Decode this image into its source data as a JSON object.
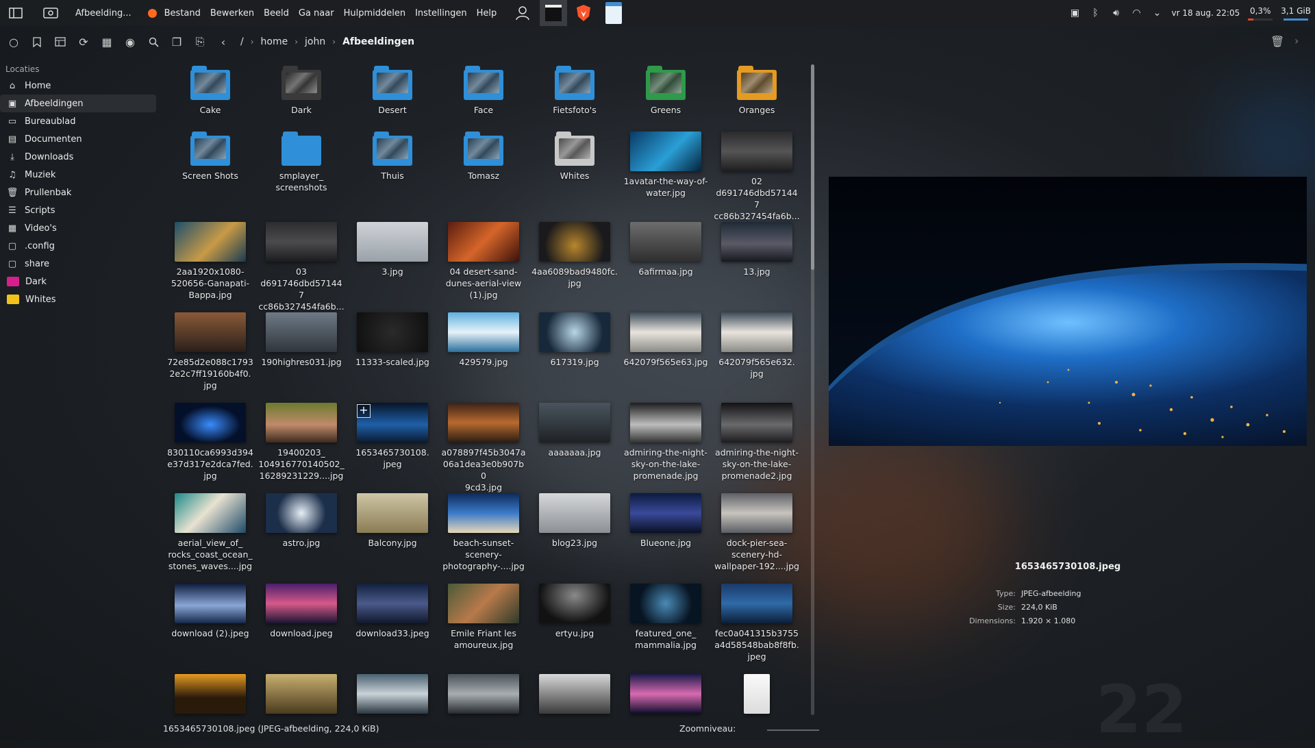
{
  "panel": {
    "app_title": "Afbeelding...",
    "menus": [
      "Bestand",
      "Bewerken",
      "Beeld",
      "Ga naar",
      "Hulpmiddelen",
      "Instellingen",
      "Help"
    ],
    "clock": "vr 18 aug. 22:05",
    "cpu": "0,3%",
    "mem": "3,1 GiB",
    "cpu_level": 0.3,
    "mem_level": 100
  },
  "breadcrumb": {
    "root": "/",
    "parts": [
      "home",
      "john"
    ],
    "current": "Afbeeldingen"
  },
  "sidebar": {
    "heading": "Locaties",
    "items": [
      {
        "label": "Home",
        "icon": "home-icon"
      },
      {
        "label": "Afbeeldingen",
        "icon": "image-icon"
      },
      {
        "label": "Bureaublad",
        "icon": "desktop-icon"
      },
      {
        "label": "Documenten",
        "icon": "document-icon"
      },
      {
        "label": "Downloads",
        "icon": "download-icon"
      },
      {
        "label": "Muziek",
        "icon": "music-icon"
      },
      {
        "label": "Prullenbak",
        "icon": "trash-icon"
      },
      {
        "label": "Scripts",
        "icon": "script-icon"
      },
      {
        "label": "Video's",
        "icon": "video-icon"
      },
      {
        "label": ".config",
        "icon": "folder-icon"
      },
      {
        "label": "share",
        "icon": "folder-icon"
      },
      {
        "label": "Dark",
        "icon": "folder-magenta-icon"
      },
      {
        "label": "Whites",
        "icon": "folder-yellow-icon"
      }
    ]
  },
  "folders": [
    {
      "label": "Cake",
      "color": "#2f8fd8"
    },
    {
      "label": "Dark",
      "color": "#3a3a3a"
    },
    {
      "label": "Desert",
      "color": "#2f8fd8"
    },
    {
      "label": "Face",
      "color": "#2f8fd8"
    },
    {
      "label": "Fietsfoto's",
      "color": "#2f8fd8"
    },
    {
      "label": "Greens",
      "color": "#2e9a4a"
    },
    {
      "label": "Oranges",
      "color": "#e59a22"
    },
    {
      "label": "Screen Shots",
      "color": "#2f8fd8"
    },
    {
      "label": "smplayer_\nscreenshots",
      "color": "#2f8fd8"
    },
    {
      "label": "Thuis",
      "color": "#2f8fd8"
    },
    {
      "label": "Tomasz",
      "color": "#2f8fd8"
    },
    {
      "label": "Whites",
      "color": "#c8c8c8"
    }
  ],
  "files": [
    {
      "label": "1avatar-the-way-of-\nwater.jpg",
      "bg": "linear-gradient(135deg,#0a3a66,#2a9fd6 55%,#05223a)"
    },
    {
      "label": "02\nd691746dbd571447\ncc86b327454fa6b...",
      "bg": "linear-gradient(180deg,#2a2a2c,#555 50%,#1d1d1f)"
    },
    {
      "label": "2aa1920x1080-\n520656-Ganapati-\nBappa.jpg",
      "bg": "linear-gradient(135deg,#1d4f6c,#c89a46 55%,#193a52)"
    },
    {
      "label": "03\nd691746dbd571447\ncc86b327454fa6b...",
      "bg": "linear-gradient(180deg,#2c2c2e,#4b4b4d 50%,#1c1c1e)"
    },
    {
      "label": "3.jpg",
      "bg": "linear-gradient(180deg,#cfd3d8,#9aa1a8)"
    },
    {
      "label": "04 desert-sand-\ndunes-aerial-view\n(1).jpg",
      "bg": "linear-gradient(135deg,#5a1e10,#d6652a 50%,#3a120a)"
    },
    {
      "label": "4aa6089bad9480fc.\njpg",
      "bg": "radial-gradient(circle at 50% 60%,#b8862d,#1a1a1c 70%)"
    },
    {
      "label": "6afirmaa.jpg",
      "bg": "linear-gradient(180deg,#6d6d6d,#2e2e2e)"
    },
    {
      "label": "13.jpg",
      "bg": "linear-gradient(180deg,#1e2a36,#5a5a66 55%,#16191f)"
    },
    {
      "label": "72e85d2e088c1793\n2e2c7ff19160b4f0.\njpg",
      "bg": "linear-gradient(180deg,#8a5a38,#2a1f1a)"
    },
    {
      "label": "190highres031.jpg",
      "bg": "linear-gradient(180deg,#6f7a86,#2f353c)"
    },
    {
      "label": "11333-scaled.jpg",
      "bg": "radial-gradient(circle at 50% 50%,#2a2a2a,#0e0e0e)"
    },
    {
      "label": "429579.jpg",
      "bg": "linear-gradient(180deg,#5fb0e0,#e6f2f8 50%,#2b6f9c)"
    },
    {
      "label": "617319.jpg",
      "bg": "radial-gradient(circle at 50% 50%,#b8d6e6,#16283a 70%)"
    },
    {
      "label": "642079f565e63.jpg",
      "bg": "linear-gradient(180deg,#3c4a58,#e8e4dc 50%,#8a8a86)"
    },
    {
      "label": "642079f565e632.\njpg",
      "bg": "linear-gradient(180deg,#3c4a58,#e8e4dc 50%,#8a8a86)"
    },
    {
      "label": "830110ca6993d394\ne37d317e2dca7fed.\njpg",
      "bg": "radial-gradient(ellipse at 50% 55%,#3a8cff,#04102a 60%)"
    },
    {
      "label": "19400203_\n104916770140502_\n16289231229....jpg",
      "bg": "linear-gradient(180deg,#6c7a2e,#c08a6a 55%,#3d2a1e)"
    },
    {
      "label": "1653465730108.\njpeg",
      "bg": "linear-gradient(180deg,#071428,#1f5fa8 55%,#0a1a30)"
    },
    {
      "label": "a078897f45b3047a\n06a1dea3e0b907b0\n9cd3.jpg",
      "bg": "linear-gradient(180deg,#3a2218,#b86a2e 50%,#2a1c14)"
    },
    {
      "label": "aaaaaaa.jpg",
      "bg": "linear-gradient(180deg,#4a545e,#1e2226)"
    },
    {
      "label": "admiring-the-night-\nsky-on-the-lake-\npromenade.jpg",
      "bg": "linear-gradient(180deg,#1c1c1e,#bdbdbd 55%,#333)"
    },
    {
      "label": "admiring-the-night-\nsky-on-the-lake-\npromenade2.jpg",
      "bg": "linear-gradient(180deg,#121214,#6a6a6c 55%,#1c1c1e)"
    },
    {
      "label": "aerial_view_of_\nrocks_coast_ocean_\nstones_waves....jpg",
      "bg": "linear-gradient(135deg,#1b8a8a,#e8e2d0 45%,#1f4a6a)"
    },
    {
      "label": "astro.jpg",
      "bg": "radial-gradient(circle at 50% 50%,#e6eef6,#1b2e4a 60%)"
    },
    {
      "label": "Balcony.jpg",
      "bg": "linear-gradient(180deg,#cfc6a6,#8a7c54)"
    },
    {
      "label": "beach-sunset-\nscenery-\nphotography-....jpg",
      "bg": "linear-gradient(180deg,#0d2a5a,#3b7ac8 50%,#e6d8b8)"
    },
    {
      "label": "blog23.jpg",
      "bg": "linear-gradient(180deg,#d6d8da,#8c9094)"
    },
    {
      "label": "Blueone.jpg",
      "bg": "linear-gradient(180deg,#0c1a3e,#3a4a9a 50%,#0a1024)"
    },
    {
      "label": "dock-pier-sea-\nscenery-hd-\nwallpaper-192....jpg",
      "bg": "linear-gradient(180deg,#5d6066,#c8c4be 50%,#5a5e64)"
    },
    {
      "label": "download (2).jpeg",
      "bg": "linear-gradient(180deg,#0e1c3e,#8aa6d6 55%,#142848)"
    },
    {
      "label": "download.jpeg",
      "bg": "linear-gradient(180deg,#4a1e6a,#d65a8a 50%,#1a1430)"
    },
    {
      "label": "download33.jpeg",
      "bg": "linear-gradient(180deg,#12203e,#4a5a8a 50%,#10182c)"
    },
    {
      "label": "Emile Friant les\namoureux.jpg",
      "bg": "linear-gradient(135deg,#4a5a3a,#b87a4a 50%,#2e3a2a)"
    },
    {
      "label": "ertyu.jpg",
      "bg": "radial-gradient(ellipse at 50% 30%,#8a8a8a,#121212 70%)"
    },
    {
      "label": "featured_one_\nmammalia.jpg",
      "bg": "radial-gradient(circle at 50% 50%,#4a8ab6,#071422 65%)"
    },
    {
      "label": "fec0a041315b3755\na4d58548bab8f8fb.\njpeg",
      "bg": "linear-gradient(180deg,#1a3a6a,#2f6aa8 50%,#0c1e36)"
    },
    {
      "label": "",
      "bg": "linear-gradient(180deg,#e59a22,#2a1a0a 60%)"
    },
    {
      "label": "",
      "bg": "linear-gradient(180deg,#c8b070,#4a3a1e)"
    },
    {
      "label": "",
      "bg": "linear-gradient(180deg,#4a6070,#c8d2d8 50%,#2a3640)"
    },
    {
      "label": "",
      "bg": "linear-gradient(180deg,#4a5258,#a8aeb2 50%,#262a2e)"
    },
    {
      "label": "",
      "bg": "linear-gradient(180deg,#d8d8d8,#3a3a3a)"
    },
    {
      "label": "",
      "bg": "linear-gradient(180deg,#1a1a4a,#d86ab0 50%,#0c0c2a)"
    },
    {
      "label": "",
      "bg": "linear-gradient(180deg,#fafafa,#dcdcdc)"
    }
  ],
  "preview": {
    "filename": "1653465730108.jpeg",
    "type_key": "Type:",
    "type_val": "JPEG-afbeelding",
    "size_key": "Size:",
    "size_val": "224,0 KiB",
    "dim_key": "Dimensions:",
    "dim_val": "1.920 × 1.080"
  },
  "status": {
    "text": "1653465730108.jpeg (JPEG-afbeelding, 224,0 KiB)",
    "zoom_label": "Zoomniveau:"
  }
}
